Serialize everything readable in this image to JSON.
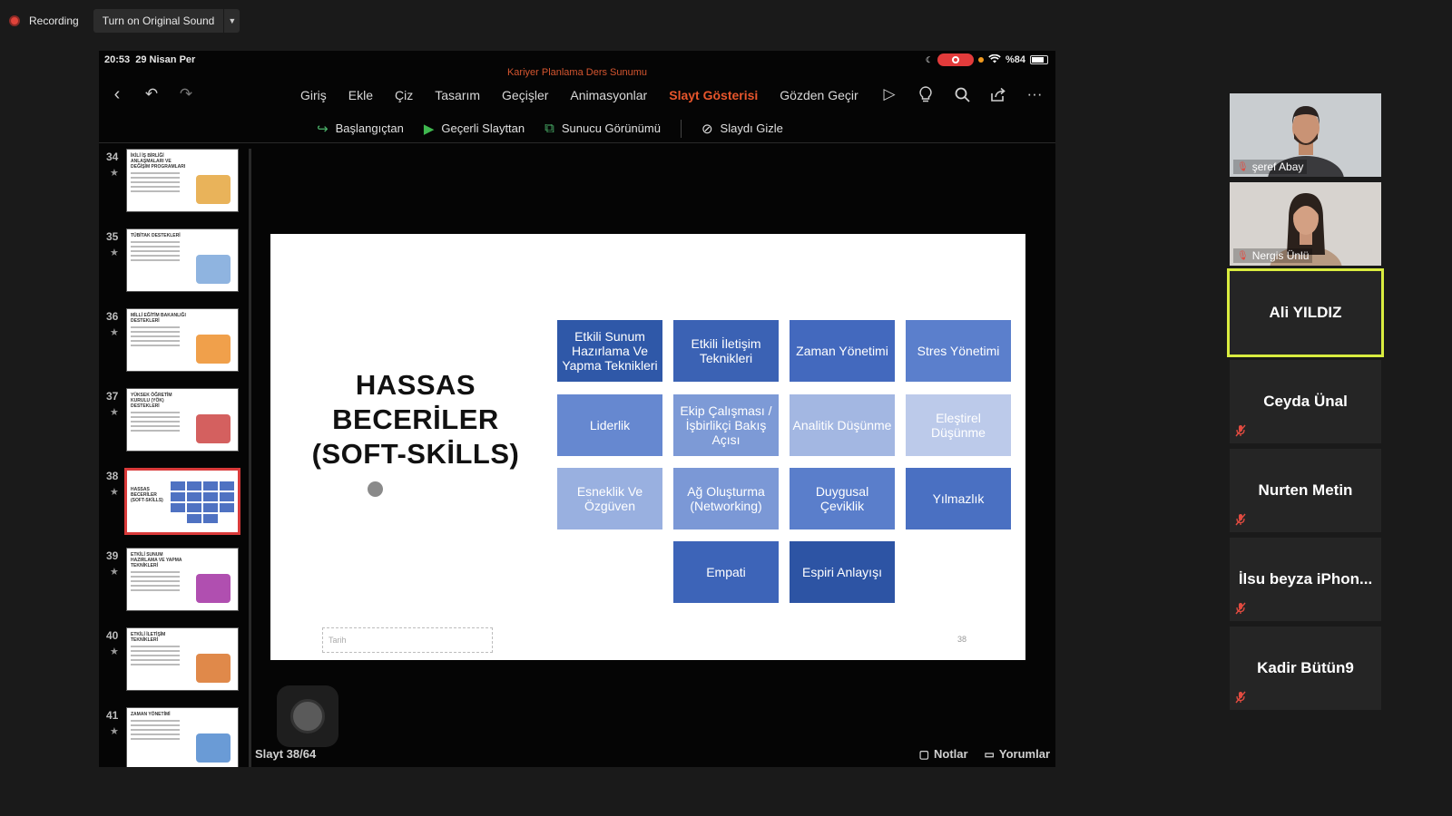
{
  "zoom": {
    "recording_label": "Recording",
    "original_sound_label": "Turn on Original Sound"
  },
  "ipad": {
    "time": "20:53",
    "date": "29 Nisan Per",
    "battery": "%84",
    "document_title": "Kariyer Planlama Ders Sunumu"
  },
  "ribbon": {
    "tabs": [
      {
        "label": "Giriş",
        "active": false
      },
      {
        "label": "Ekle",
        "active": false
      },
      {
        "label": "Çiz",
        "active": false
      },
      {
        "label": "Tasarım",
        "active": false
      },
      {
        "label": "Geçişler",
        "active": false
      },
      {
        "label": "Animasyonlar",
        "active": false
      },
      {
        "label": "Slayt Gösterisi",
        "active": true
      },
      {
        "label": "Gözden Geçir",
        "active": false
      }
    ],
    "commands": {
      "from_start": "Başlangıçtan",
      "from_current": "Geçerli Slayttan",
      "presenter_view": "Sunucu Görünümü",
      "hide_slide": "Slaydı Gizle"
    }
  },
  "thumbnails": [
    {
      "num": "34",
      "title": "İKİLİ İŞ BİRLİĞİ ANLAŞMALARI VE DEĞİŞİM PROGRAMLARI",
      "art": "#e9b35a",
      "selected": false
    },
    {
      "num": "35",
      "title": "TÜBİTAK DESTEKLERİ",
      "art": "#8fb4e0",
      "selected": false
    },
    {
      "num": "36",
      "title": "MİLLİ EĞİTİM BAKANLIĞI DESTEKLERİ",
      "art": "#f0a04b",
      "selected": false
    },
    {
      "num": "37",
      "title": "YÜKSEK ÖĞRETİM KURULU (YÖK) DESTEKLERİ",
      "art": "#d4605f",
      "selected": false
    },
    {
      "num": "38",
      "title": "HASSAS BECERİLER (SOFT-SKİLLS)",
      "art": "",
      "selected": true
    },
    {
      "num": "39",
      "title": "ETKİLİ SUNUM HAZIRLAMA VE YAPMA TEKNİKLERİ",
      "art": "#b04fb0",
      "selected": false
    },
    {
      "num": "40",
      "title": "ETKİLİ İLETİŞİM TEKNİKLERİ",
      "art": "#e0894a",
      "selected": false
    },
    {
      "num": "41",
      "title": "ZAMAN YÖNETİMİ",
      "art": "#6a9bd6",
      "selected": false
    }
  ],
  "slide": {
    "title": "HASSAS BECERİLER (SOFT-SKİLLS)",
    "date_placeholder": "Tarih",
    "page_number": "38",
    "skills": [
      {
        "label": "Etkili Sunum Hazırlama Ve Yapma Teknikleri",
        "color": "#2f58a8"
      },
      {
        "label": "Etkili İletişim Teknikleri",
        "color": "#3b62b4"
      },
      {
        "label": "Zaman Yönetimi",
        "color": "#4369be"
      },
      {
        "label": "Stres Yönetimi",
        "color": "#5b7fcc"
      },
      {
        "label": "Liderlik",
        "color": "#6688d0"
      },
      {
        "label": "Ekip Çalışması / İşbirlikçi Bakış Açısı",
        "color": "#7d9ad6"
      },
      {
        "label": "Analitik Düşünme",
        "color": "#a3b7e2"
      },
      {
        "label": "Eleştirel Düşünme",
        "color": "#bccaea"
      },
      {
        "label": "Esneklik Ve Özgüven",
        "color": "#99b0e0"
      },
      {
        "label": "Ağ Oluşturma (Networking)",
        "color": "#7b98d6"
      },
      {
        "label": "Duygusal Çeviklik",
        "color": "#5a7ecb"
      },
      {
        "label": "Yılmazlık",
        "color": "#4a70c2"
      },
      {
        "label": "Empati",
        "color": "#3d64b8"
      },
      {
        "label": "Espiri Anlayışı",
        "color": "#2d54a4"
      }
    ]
  },
  "footer": {
    "slide_count": "Slayt 38/64",
    "notes": "Notlar",
    "comments": "Yorumlar"
  },
  "participants": [
    {
      "name": "şeref Abay",
      "video": true
    },
    {
      "name": "Nergis Ünlü",
      "video": true
    },
    {
      "name": "Ali YILDIZ",
      "video": false,
      "active": true
    },
    {
      "name": "Ceyda Ünal",
      "video": false
    },
    {
      "name": "Nurten Metin",
      "video": false
    },
    {
      "name": "İlsu beyza iPhon...",
      "video": false
    },
    {
      "name": "Kadir Bütün9",
      "video": false
    }
  ]
}
